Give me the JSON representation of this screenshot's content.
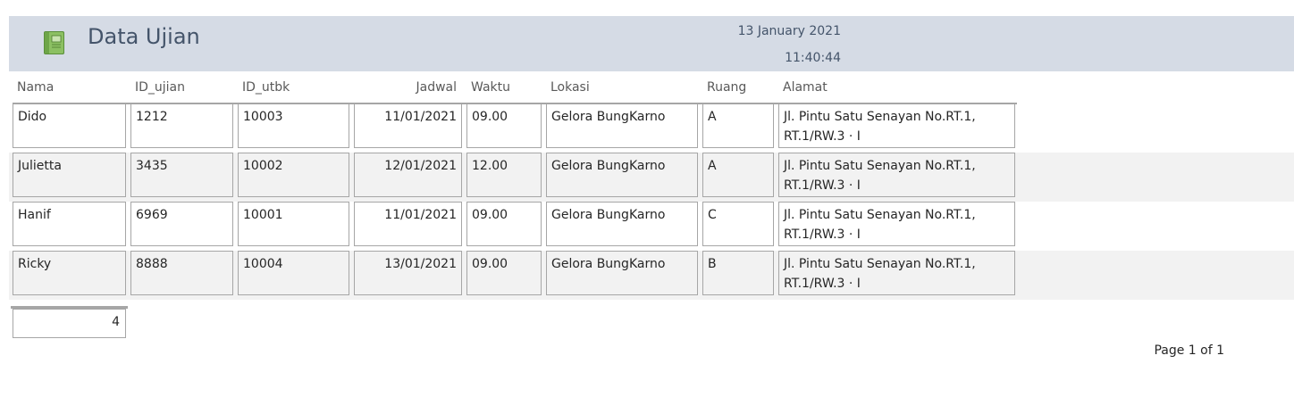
{
  "header": {
    "title": "Data Ujian",
    "date": "13 January 2021",
    "time": "11:40:44",
    "icon": "report-notebook-icon"
  },
  "columns": {
    "nama": "Nama",
    "id_ujian": "ID_ujian",
    "id_utbk": "ID_utbk",
    "jadwal": "Jadwal",
    "waktu": "Waktu",
    "lokasi": "Lokasi",
    "ruang": "Ruang",
    "alamat": "Alamat"
  },
  "rows": [
    {
      "nama": "Dido",
      "id_ujian": "1212",
      "id_utbk": "10003",
      "jadwal": "11/01/2021",
      "waktu": "09.00",
      "lokasi": "Gelora BungKarno",
      "ruang": "A",
      "alamat": "Jl. Pintu Satu Senayan No.RT.1, RT.1/RW.3 · I"
    },
    {
      "nama": "Julietta",
      "id_ujian": "3435",
      "id_utbk": "10002",
      "jadwal": "12/01/2021",
      "waktu": "12.00",
      "lokasi": "Gelora BungKarno",
      "ruang": "A",
      "alamat": "Jl. Pintu Satu Senayan No.RT.1, RT.1/RW.3 · I"
    },
    {
      "nama": "Hanif",
      "id_ujian": "6969",
      "id_utbk": "10001",
      "jadwal": "11/01/2021",
      "waktu": "09.00",
      "lokasi": "Gelora BungKarno",
      "ruang": "C",
      "alamat": "Jl. Pintu Satu Senayan No.RT.1, RT.1/RW.3 · I"
    },
    {
      "nama": "Ricky",
      "id_ujian": "8888",
      "id_utbk": "10004",
      "jadwal": "13/01/2021",
      "waktu": "09.00",
      "lokasi": "Gelora BungKarno",
      "ruang": "B",
      "alamat": "Jl. Pintu Satu Senayan No.RT.1, RT.1/RW.3 · I"
    }
  ],
  "footer": {
    "total": "4",
    "page": "Page 1 of 1"
  },
  "colors": {
    "header_band": "#d5dbe5",
    "title_text": "#44546a",
    "alt_row": "#f2f2f2",
    "cell_border": "#a6a6a6"
  }
}
